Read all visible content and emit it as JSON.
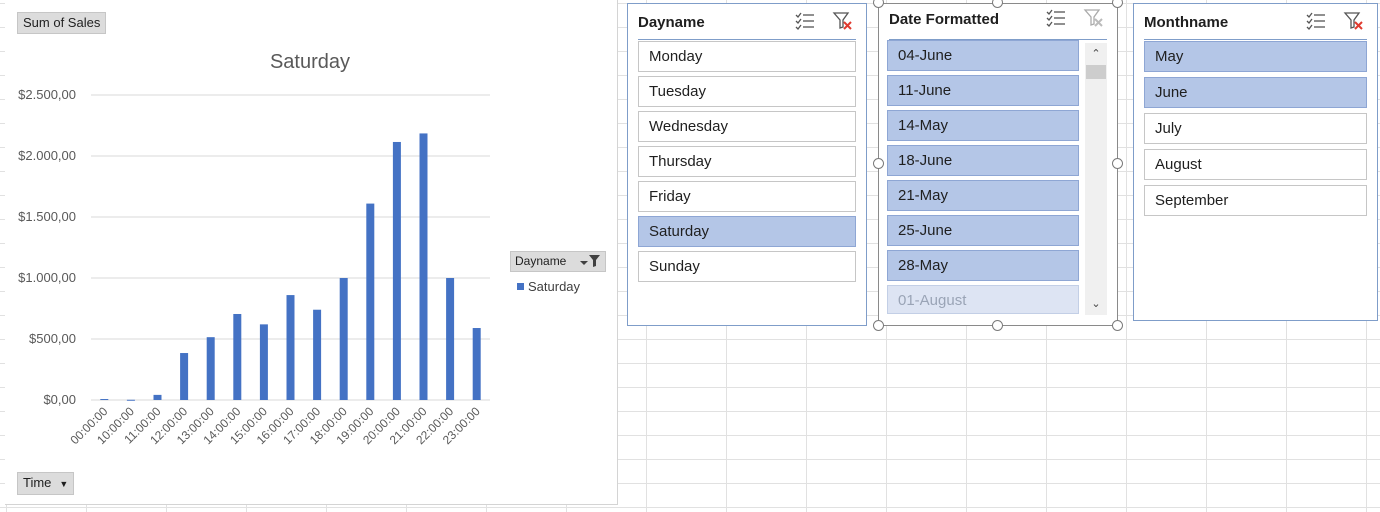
{
  "chart": {
    "field_button": "Sum of Sales",
    "axis_field_button": "Time",
    "legend_field": "Dayname",
    "legend_entry": "Saturday",
    "bar_color": "#4472c4"
  },
  "chart_data": {
    "type": "bar",
    "title": "Saturday",
    "xlabel": "",
    "ylabel": "",
    "categories": [
      "00:00:00",
      "10:00:00",
      "11:00:00",
      "12:00:00",
      "13:00:00",
      "14:00:00",
      "15:00:00",
      "16:00:00",
      "17:00:00",
      "18:00:00",
      "19:00:00",
      "20:00:00",
      "21:00:00",
      "22:00:00",
      "23:00:00"
    ],
    "series": [
      {
        "name": "Saturday",
        "values": [
          8,
          2,
          42,
          385,
          515,
          705,
          620,
          860,
          740,
          1000,
          1610,
          2115,
          2185,
          1000,
          590
        ]
      }
    ],
    "ylim": [
      0,
      2500
    ],
    "yticks": [
      0,
      500,
      1000,
      1500,
      2000,
      2500
    ],
    "ytick_labels": [
      "$0,00",
      "$500,00",
      "$1.000,00",
      "$1.500,00",
      "$2.000,00",
      "$2.500,00"
    ],
    "grid": true,
    "legend": "right"
  },
  "slicers": {
    "dayname": {
      "title": "Dayname",
      "items": [
        {
          "label": "Monday",
          "state": "normal"
        },
        {
          "label": "Tuesday",
          "state": "normal"
        },
        {
          "label": "Wednesday",
          "state": "normal"
        },
        {
          "label": "Thursday",
          "state": "normal"
        },
        {
          "label": "Friday",
          "state": "normal"
        },
        {
          "label": "Saturday",
          "state": "selected"
        },
        {
          "label": "Sunday",
          "state": "normal"
        }
      ]
    },
    "date_formatted": {
      "title": "Date Formatted",
      "items": [
        {
          "label": "04-June",
          "state": "selected"
        },
        {
          "label": "11-June",
          "state": "selected"
        },
        {
          "label": "14-May",
          "state": "selected"
        },
        {
          "label": "18-June",
          "state": "selected"
        },
        {
          "label": "21-May",
          "state": "selected"
        },
        {
          "label": "25-June",
          "state": "selected"
        },
        {
          "label": "28-May",
          "state": "selected"
        },
        {
          "label": "01-August",
          "state": "nodata"
        }
      ]
    },
    "monthname": {
      "title": "Monthname",
      "items": [
        {
          "label": "May",
          "state": "selected"
        },
        {
          "label": "June",
          "state": "selected"
        },
        {
          "label": "July",
          "state": "normal"
        },
        {
          "label": "August",
          "state": "normal"
        },
        {
          "label": "September",
          "state": "normal"
        }
      ]
    }
  },
  "icons": {
    "multi_select": "multi-select-icon",
    "clear_filter": "clear-filter-icon"
  }
}
